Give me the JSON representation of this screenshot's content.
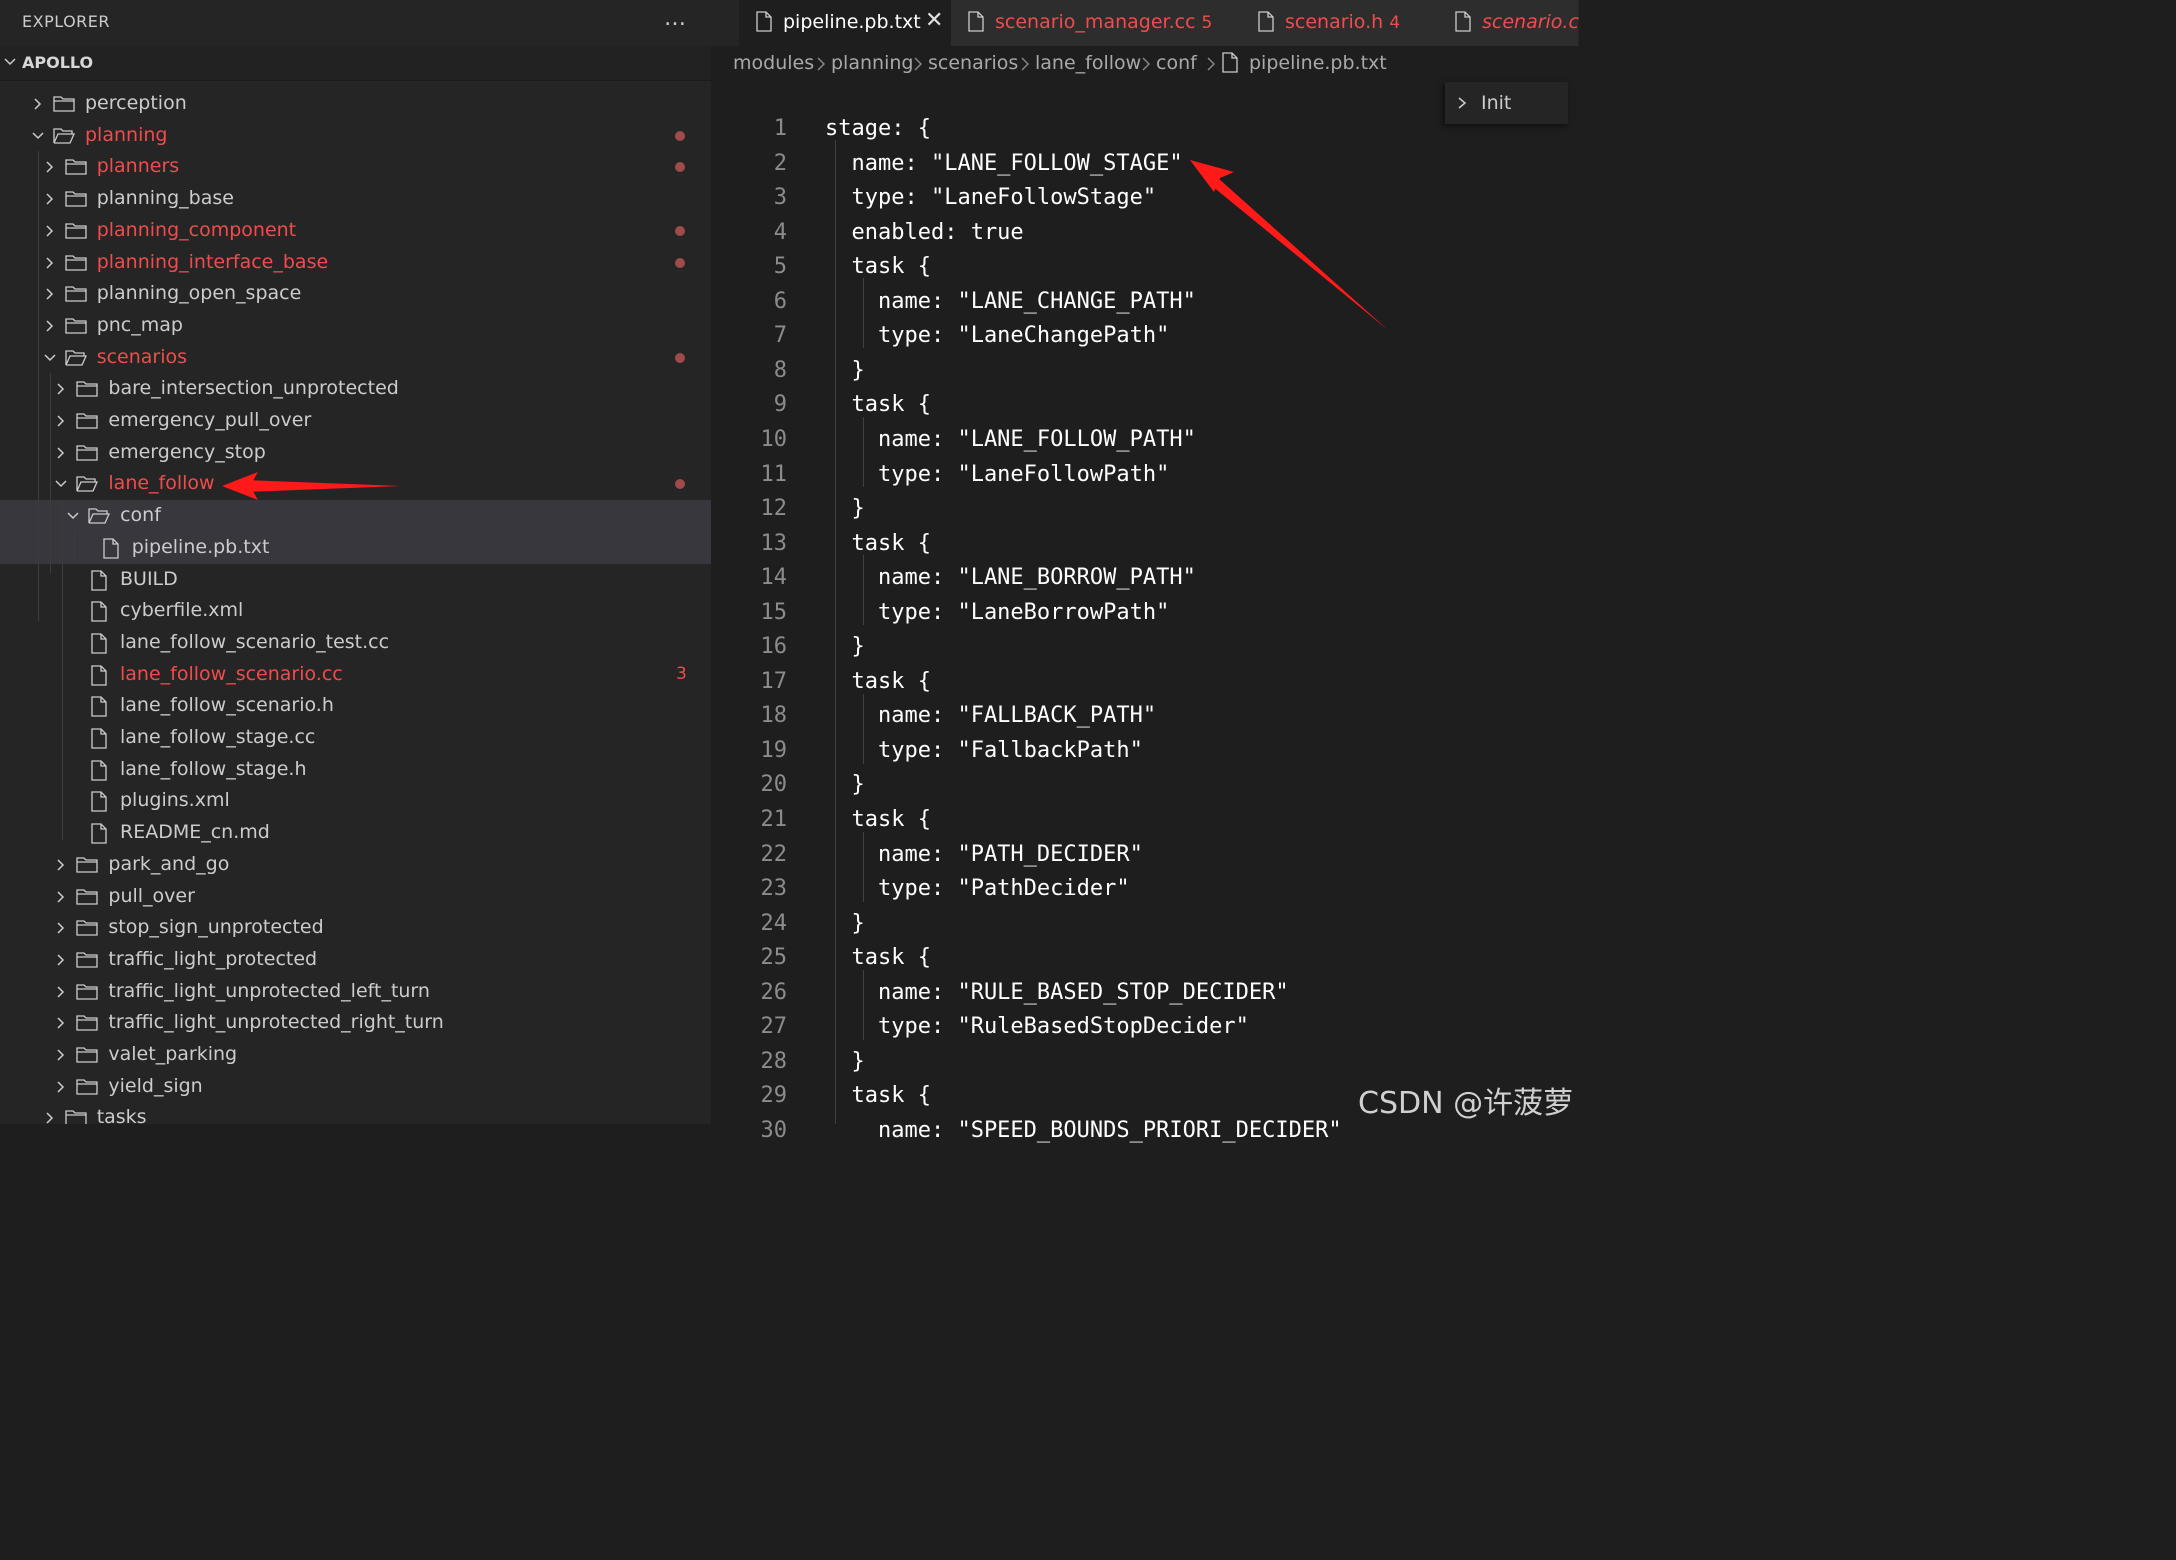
{
  "sidebar": {
    "title": "EXPLORER",
    "more_icon": "…",
    "section_label": "APOLLO",
    "tree": [
      {
        "label": "perception",
        "type": "folder",
        "depth": 0,
        "expanded": false,
        "modified": false
      },
      {
        "label": "planning",
        "type": "folder",
        "depth": 0,
        "expanded": true,
        "modified": true,
        "badge": "dot"
      },
      {
        "label": "planners",
        "type": "folder",
        "depth": 1,
        "expanded": false,
        "modified": true,
        "badge": "dot"
      },
      {
        "label": "planning_base",
        "type": "folder",
        "depth": 1,
        "expanded": false,
        "modified": false
      },
      {
        "label": "planning_component",
        "type": "folder",
        "depth": 1,
        "expanded": false,
        "modified": true,
        "badge": "dot"
      },
      {
        "label": "planning_interface_base",
        "type": "folder",
        "depth": 1,
        "expanded": false,
        "modified": true,
        "badge": "dot"
      },
      {
        "label": "planning_open_space",
        "type": "folder",
        "depth": 1,
        "expanded": false,
        "modified": false
      },
      {
        "label": "pnc_map",
        "type": "folder",
        "depth": 1,
        "expanded": false,
        "modified": false
      },
      {
        "label": "scenarios",
        "type": "folder",
        "depth": 1,
        "expanded": true,
        "modified": true,
        "badge": "dot"
      },
      {
        "label": "bare_intersection_unprotected",
        "type": "folder",
        "depth": 2,
        "expanded": false,
        "modified": false
      },
      {
        "label": "emergency_pull_over",
        "type": "folder",
        "depth": 2,
        "expanded": false,
        "modified": false
      },
      {
        "label": "emergency_stop",
        "type": "folder",
        "depth": 2,
        "expanded": false,
        "modified": false
      },
      {
        "label": "lane_follow",
        "type": "folder",
        "depth": 2,
        "expanded": true,
        "modified": true,
        "badge": "dot"
      },
      {
        "label": "conf",
        "type": "folder",
        "depth": 3,
        "expanded": true,
        "modified": false,
        "selected": true
      },
      {
        "label": "pipeline.pb.txt",
        "type": "file",
        "depth": 4,
        "modified": false,
        "selected": true
      },
      {
        "label": "BUILD",
        "type": "file",
        "depth": 3,
        "modified": false
      },
      {
        "label": "cyberfile.xml",
        "type": "file",
        "depth": 3,
        "modified": false
      },
      {
        "label": "lane_follow_scenario_test.cc",
        "type": "file",
        "depth": 3,
        "modified": false
      },
      {
        "label": "lane_follow_scenario.cc",
        "type": "file",
        "depth": 3,
        "modified": true,
        "badge": "3"
      },
      {
        "label": "lane_follow_scenario.h",
        "type": "file",
        "depth": 3,
        "modified": false
      },
      {
        "label": "lane_follow_stage.cc",
        "type": "file",
        "depth": 3,
        "modified": false
      },
      {
        "label": "lane_follow_stage.h",
        "type": "file",
        "depth": 3,
        "modified": false
      },
      {
        "label": "plugins.xml",
        "type": "file",
        "depth": 3,
        "modified": false
      },
      {
        "label": "README_cn.md",
        "type": "file",
        "depth": 3,
        "modified": false
      },
      {
        "label": "park_and_go",
        "type": "folder",
        "depth": 2,
        "expanded": false,
        "modified": false
      },
      {
        "label": "pull_over",
        "type": "folder",
        "depth": 2,
        "expanded": false,
        "modified": false
      },
      {
        "label": "stop_sign_unprotected",
        "type": "folder",
        "depth": 2,
        "expanded": false,
        "modified": false
      },
      {
        "label": "traffic_light_protected",
        "type": "folder",
        "depth": 2,
        "expanded": false,
        "modified": false
      },
      {
        "label": "traffic_light_unprotected_left_turn",
        "type": "folder",
        "depth": 2,
        "expanded": false,
        "modified": false
      },
      {
        "label": "traffic_light_unprotected_right_turn",
        "type": "folder",
        "depth": 2,
        "expanded": false,
        "modified": false
      },
      {
        "label": "valet_parking",
        "type": "folder",
        "depth": 2,
        "expanded": false,
        "modified": false
      },
      {
        "label": "yield_sign",
        "type": "folder",
        "depth": 2,
        "expanded": false,
        "modified": false
      },
      {
        "label": "tasks",
        "type": "folder",
        "depth": 1,
        "expanded": false,
        "modified": false
      }
    ]
  },
  "tabs": [
    {
      "label": "pipeline.pb.txt",
      "active": true,
      "close_icon": "✕"
    },
    {
      "label": "scenario_manager.cc",
      "count": "5",
      "active": false
    },
    {
      "label": "scenario.h",
      "count": "4",
      "active": false
    },
    {
      "label": "scenario.c",
      "active": false,
      "italic": true
    }
  ],
  "breadcrumb": [
    "modules",
    "planning",
    "scenarios",
    "lane_follow",
    "conf",
    "pipeline.pb.txt"
  ],
  "outline": {
    "label": "Init"
  },
  "editor": {
    "lines": [
      "stage: {",
      "  name: \"LANE_FOLLOW_STAGE\"",
      "  type: \"LaneFollowStage\"",
      "  enabled: true",
      "  task {",
      "    name: \"LANE_CHANGE_PATH\"",
      "    type: \"LaneChangePath\"",
      "  }",
      "  task {",
      "    name: \"LANE_FOLLOW_PATH\"",
      "    type: \"LaneFollowPath\"",
      "  }",
      "  task {",
      "    name: \"LANE_BORROW_PATH\"",
      "    type: \"LaneBorrowPath\"",
      "  }",
      "  task {",
      "    name: \"FALLBACK_PATH\"",
      "    type: \"FallbackPath\"",
      "  }",
      "  task {",
      "    name: \"PATH_DECIDER\"",
      "    type: \"PathDecider\"",
      "  }",
      "  task {",
      "    name: \"RULE_BASED_STOP_DECIDER\"",
      "    type: \"RuleBasedStopDecider\"",
      "  }",
      "  task {",
      "    name: \"SPEED_BOUNDS_PRIORI_DECIDER\""
    ]
  },
  "watermark": "CSDN @许菠萝",
  "colors": {
    "modified": "#f14c4c",
    "annotation_arrow": "#ff1a1a",
    "selection": "#37373d"
  }
}
